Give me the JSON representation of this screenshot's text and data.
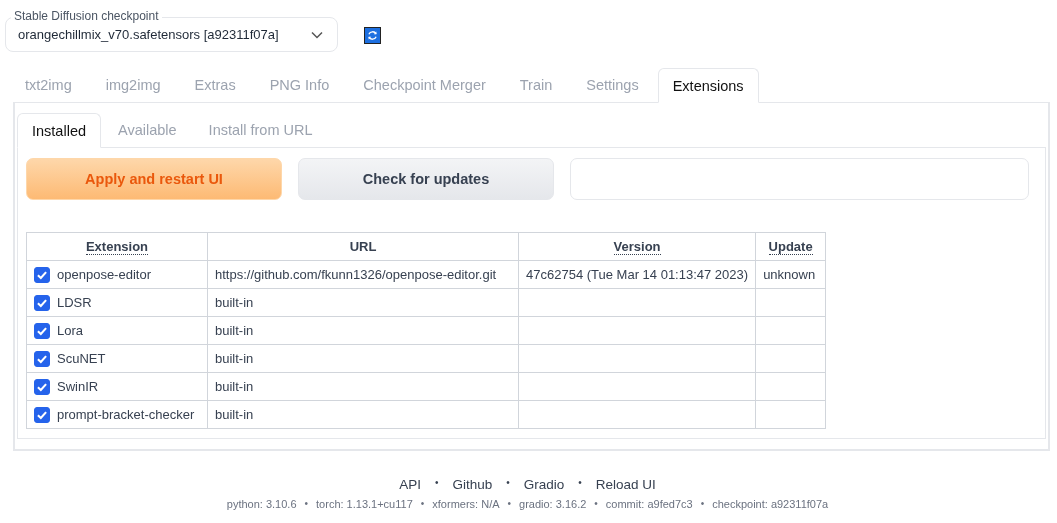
{
  "checkpoint": {
    "label": "Stable Diffusion checkpoint",
    "value": "orangechillmix_v70.safetensors [a92311f07a]"
  },
  "tabs": [
    {
      "label": "txt2img",
      "selected": false
    },
    {
      "label": "img2img",
      "selected": false
    },
    {
      "label": "Extras",
      "selected": false
    },
    {
      "label": "PNG Info",
      "selected": false
    },
    {
      "label": "Checkpoint Merger",
      "selected": false
    },
    {
      "label": "Train",
      "selected": false
    },
    {
      "label": "Settings",
      "selected": false
    },
    {
      "label": "Extensions",
      "selected": true
    }
  ],
  "subtabs": [
    {
      "label": "Installed",
      "selected": true
    },
    {
      "label": "Available",
      "selected": false
    },
    {
      "label": "Install from URL",
      "selected": false
    }
  ],
  "buttons": [
    {
      "label": "Apply and restart UI",
      "kind": "primary"
    },
    {
      "label": "Check for updates",
      "kind": "secondary"
    }
  ],
  "table": {
    "columns": [
      "Extension",
      "URL",
      "Version",
      "Update"
    ],
    "rows": [
      {
        "name": "openpose-editor",
        "checked": true,
        "url": "https://github.com/fkunn1326/openpose-editor.git",
        "version": "47c62754 (Tue Mar 14 01:13:47 2023)",
        "update": "unknown"
      },
      {
        "name": "LDSR",
        "checked": true,
        "url": "built-in"
      },
      {
        "name": "Lora",
        "checked": true,
        "url": "built-in"
      },
      {
        "name": "ScuNET",
        "checked": true,
        "url": "built-in"
      },
      {
        "name": "SwinIR",
        "checked": true,
        "url": "built-in"
      },
      {
        "name": "prompt-bracket-checker",
        "checked": true,
        "url": "built-in"
      }
    ]
  },
  "footer": {
    "separator": "•",
    "links": [
      "API",
      "Github",
      "Gradio",
      "Reload UI"
    ],
    "info": [
      "python: 3.10.6",
      "torch: 1.13.1+cu117",
      "xformers: N/A",
      "gradio: 3.16.2",
      "commit: a9fed7c3",
      "checkpoint: a92311f07a"
    ]
  }
}
